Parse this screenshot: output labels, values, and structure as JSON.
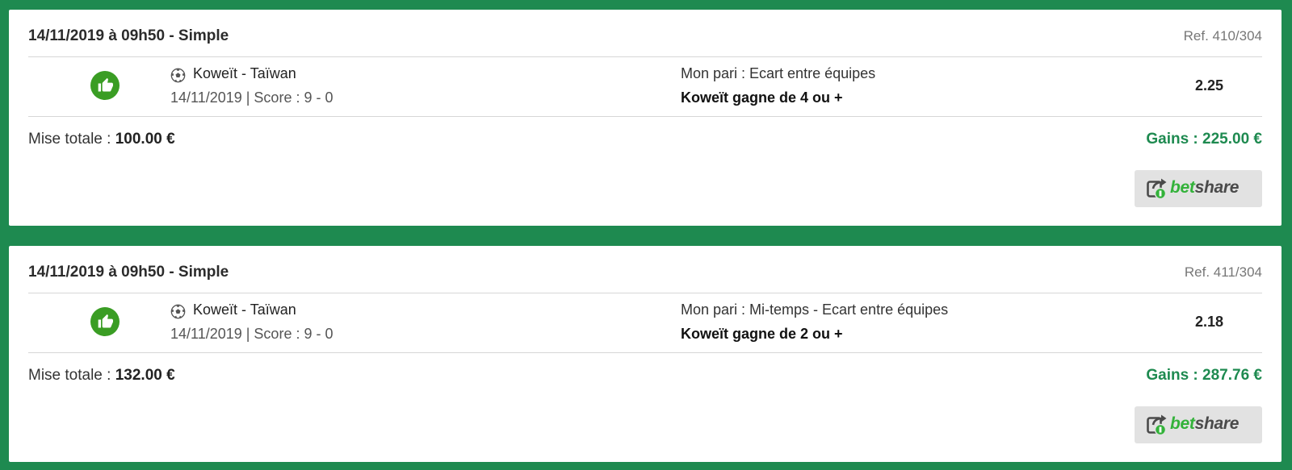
{
  "colors": {
    "background": "#1e8a50",
    "win_green": "#3a9d24",
    "gains_green": "#1e8a50",
    "betshare_green": "#33b23a"
  },
  "bets": [
    {
      "header": "14/11/2019 à 09h50 - Simple",
      "ref": "Ref. 410/304",
      "status_icon": "thumbs-up-icon",
      "sport_icon": "soccer-ball-icon",
      "match": "Koweït - Taïwan",
      "meta": "14/11/2019 | Score : 9 - 0",
      "bet_type": "Mon pari : Ecart entre équipes",
      "selection": "Koweït gagne de 4 ou +",
      "odds": "2.25",
      "stake_label": "Mise totale : ",
      "stake_value": "100.00 €",
      "gains": "Gains : 225.00 €",
      "share_bet": "bet",
      "share_share": "share"
    },
    {
      "header": "14/11/2019 à 09h50 - Simple",
      "ref": "Ref. 411/304",
      "status_icon": "thumbs-up-icon",
      "sport_icon": "soccer-ball-icon",
      "match": "Koweït - Taïwan",
      "meta": "14/11/2019 | Score : 9 - 0",
      "bet_type": "Mon pari : Mi-temps - Ecart entre équipes",
      "selection": "Koweït gagne de 2 ou +",
      "odds": "2.18",
      "stake_label": "Mise totale : ",
      "stake_value": "132.00 €",
      "gains": "Gains : 287.76 €",
      "share_bet": "bet",
      "share_share": "share"
    }
  ]
}
